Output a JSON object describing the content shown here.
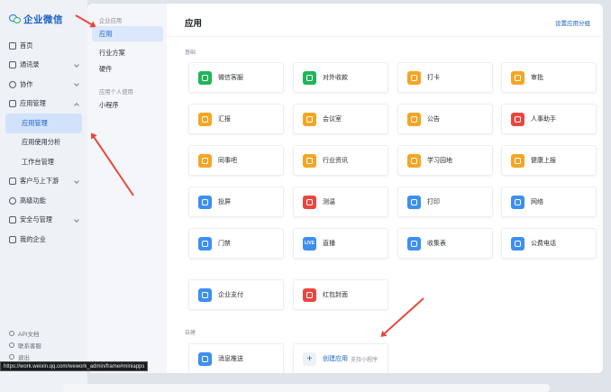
{
  "app": {
    "name": "企业微信"
  },
  "sidebar": {
    "items": [
      {
        "label": "首页",
        "icon": "home-icon"
      },
      {
        "label": "通讯录",
        "icon": "contacts-icon",
        "chevron": "down"
      },
      {
        "label": "协作",
        "icon": "collab-icon",
        "chevron": "down"
      },
      {
        "label": "应用管理",
        "icon": "apps-icon",
        "chevron": "up"
      }
    ],
    "sub_items": [
      {
        "label": "应用管理",
        "active": true
      },
      {
        "label": "应用使用分析",
        "active": false
      },
      {
        "label": "工作台管理",
        "active": false
      }
    ],
    "items2": [
      {
        "label": "客户与上下游",
        "icon": "customer-icon",
        "chevron": "down"
      },
      {
        "label": "高级功能",
        "icon": "advanced-icon"
      },
      {
        "label": "安全与管理",
        "icon": "security-icon",
        "chevron": "down"
      },
      {
        "label": "我的企业",
        "icon": "company-icon"
      }
    ],
    "bottom": [
      {
        "label": "API文档",
        "icon": "api-icon"
      },
      {
        "label": "联系客服",
        "icon": "support-icon"
      },
      {
        "label": "退出",
        "icon": "exit-icon"
      }
    ]
  },
  "status_url": "https://work.weixin.qq.com/wework_admin/frame#miniapps",
  "categories": {
    "group1_label": "企业应用",
    "group1": [
      {
        "label": "应用",
        "active": true
      },
      {
        "label": "行业方案",
        "active": false
      },
      {
        "label": "硬件",
        "active": false
      }
    ],
    "group2_label": "应用个人使用",
    "group2": [
      {
        "label": "小程序",
        "active": false
      }
    ]
  },
  "main": {
    "title": "应用",
    "header_link": "设置应用分组",
    "section_basic": "基础",
    "section_custom": "自建",
    "apps": [
      {
        "label": "微信客服",
        "color": "#21b45a",
        "icon": "wechat-service-icon"
      },
      {
        "label": "对外收款",
        "color": "#21b45a",
        "icon": "payment-icon"
      },
      {
        "label": "打卡",
        "color": "#f5a524",
        "icon": "location-pin-icon"
      },
      {
        "label": "审批",
        "color": "#f5a524",
        "icon": "approval-icon"
      },
      {
        "label": "汇报",
        "color": "#f5a524",
        "icon": "report-icon"
      },
      {
        "label": "会议室",
        "color": "#f5a524",
        "icon": "meeting-room-icon"
      },
      {
        "label": "公告",
        "color": "#f5a524",
        "icon": "announcement-icon"
      },
      {
        "label": "人事助手",
        "color": "#e8473f",
        "icon": "hr-assistant-icon"
      },
      {
        "label": "同事吧",
        "color": "#f5a524",
        "icon": "colleague-icon"
      },
      {
        "label": "行业资讯",
        "color": "#f5a524",
        "icon": "industry-news-icon"
      },
      {
        "label": "学习园地",
        "color": "#f5a524",
        "icon": "learning-icon"
      },
      {
        "label": "健康上报",
        "color": "#f5a524",
        "icon": "health-report-icon"
      },
      {
        "label": "投屏",
        "color": "#3d8ff0",
        "icon": "screen-cast-icon"
      },
      {
        "label": "测温",
        "color": "#e8473f",
        "icon": "thermometer-icon"
      },
      {
        "label": "打印",
        "color": "#3d8ff0",
        "icon": "printer-icon"
      },
      {
        "label": "网络",
        "color": "#3d8ff0",
        "icon": "network-icon"
      },
      {
        "label": "门禁",
        "color": "#3d8ff0",
        "icon": "access-control-icon"
      },
      {
        "label": "直播",
        "color": "#3d8ff0",
        "icon": "live-icon",
        "text": "LIVE"
      },
      {
        "label": "收集表",
        "color": "#3d8ff0",
        "icon": "collect-form-icon"
      },
      {
        "label": "公费电话",
        "color": "#3d8ff0",
        "icon": "phone-icon"
      },
      {
        "label": "企业支付",
        "color": "#3d8ff0",
        "icon": "enterprise-pay-icon"
      },
      {
        "label": "红包封面",
        "color": "#e8473f",
        "icon": "red-packet-icon"
      }
    ],
    "custom_apps": [
      {
        "label": "消息推送",
        "color": "#3d8ff0",
        "icon": "message-push-icon"
      },
      {
        "label": "创建应用",
        "tag": "支持小程序",
        "icon": "plus-icon"
      }
    ]
  }
}
